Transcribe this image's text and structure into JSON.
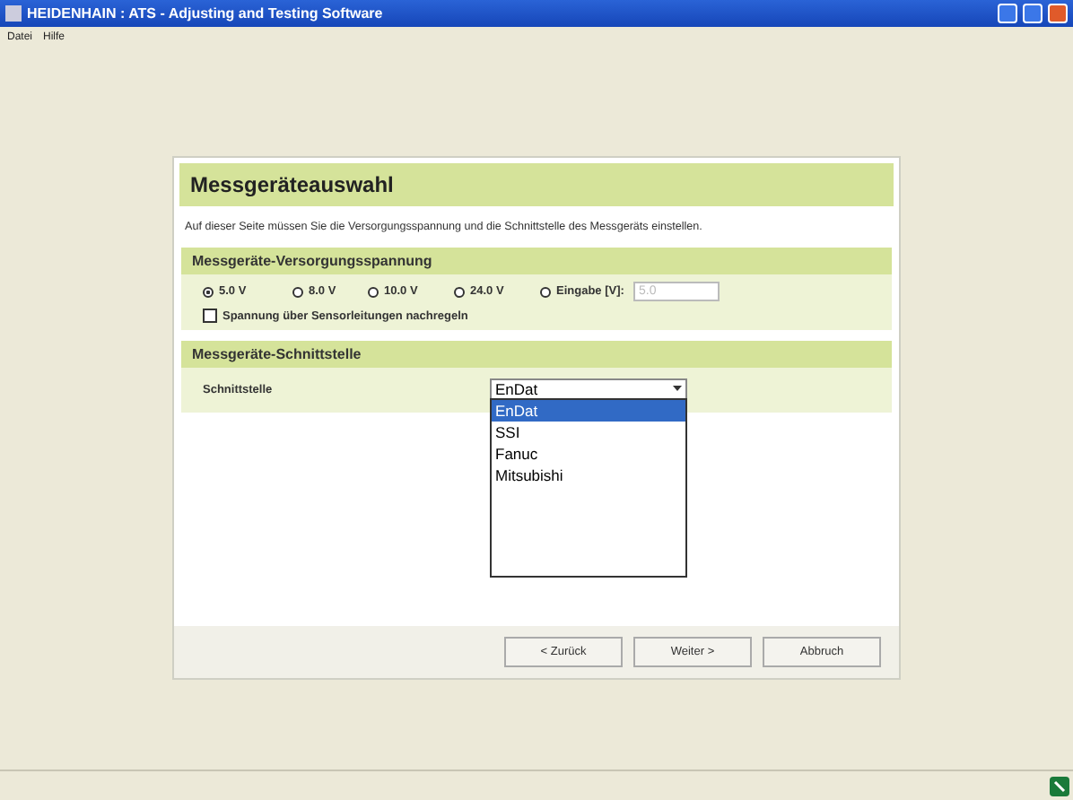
{
  "window": {
    "title": "HEIDENHAIN : ATS - Adjusting and Testing Software"
  },
  "menu": [
    "Datei",
    "Hilfe"
  ],
  "dialog": {
    "title": "Messgeräteauswahl",
    "description": "Auf dieser Seite müssen Sie die Versorgungsspannung und die Schnittstelle des Messgeräts einstellen.",
    "supply": {
      "title": "Messgeräte-Versorgungsspannung",
      "options": [
        {
          "label": "5.0 V",
          "selected": true
        },
        {
          "label": "8.0 V",
          "selected": false
        },
        {
          "label": "10.0 V",
          "selected": false
        },
        {
          "label": "24.0 V",
          "selected": false
        },
        {
          "label": "Eingabe [V]:",
          "selected": false
        }
      ],
      "input": {
        "value": "5.0",
        "disabled": true
      },
      "regulate": {
        "label": "Spannung über Sensorleitungen nachregeln",
        "checked": false
      }
    },
    "interface": {
      "title": "Messgeräte-Schnittstelle",
      "label": "Schnittstelle",
      "value": "EnDat",
      "options": [
        {
          "label": "EnDat",
          "selected": true
        },
        {
          "label": "SSI",
          "selected": false
        },
        {
          "label": "Fanuc",
          "selected": false
        },
        {
          "label": "Mitsubishi",
          "selected": false
        }
      ]
    },
    "buttons": [
      "< Zurück",
      "Weiter >",
      "Abbruch"
    ]
  }
}
